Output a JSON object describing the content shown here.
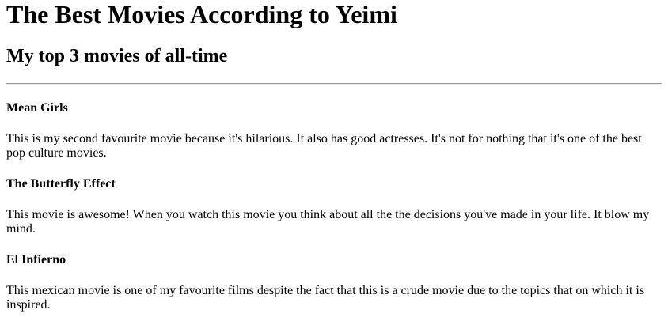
{
  "title": "The Best Movies According to Yeimi",
  "subtitle": "My top 3 movies of all-time",
  "movies": [
    {
      "name": "Mean Girls",
      "description": "This is my second favourite movie because it's hilarious. It also has good actresses. It's not for nothing that it's one of the best pop culture movies."
    },
    {
      "name": "The Butterfly Effect",
      "description": "This movie is awesome! When you watch this movie you think about all the the decisions you've made in your life. It blow my mind."
    },
    {
      "name": "El Infierno",
      "description": "This mexican movie is one of my favourite films despite the fact that this is a crude movie due to the topics that on which it is inspired."
    }
  ]
}
